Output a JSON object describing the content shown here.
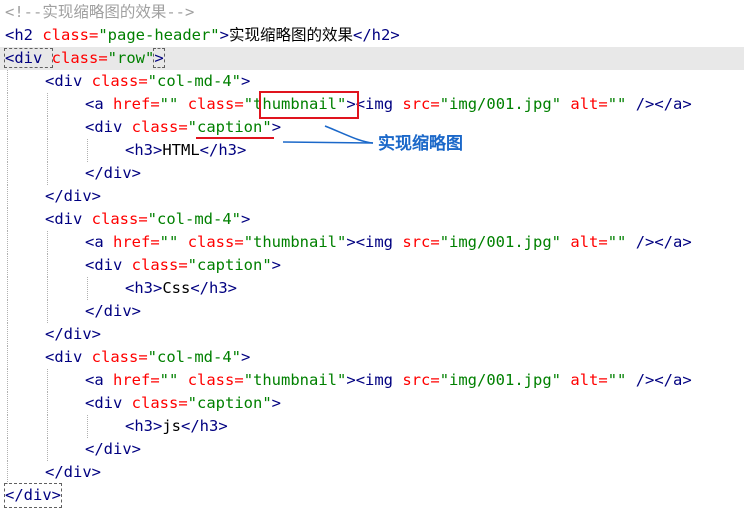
{
  "code": {
    "l1": {
      "comment": "<!--实现缩略图的效果-->"
    },
    "l2": {
      "open": "<h2 ",
      "attr": "class=",
      "value": "\"page-header\"",
      "close": ">",
      "text": "实现缩略图的效果",
      "end": "</h2>"
    },
    "l3": {
      "open": "<div ",
      "attr": "class=",
      "value": "\"row\"",
      "close": ">"
    },
    "l4": {
      "open": "<div ",
      "attr": "class=",
      "value": "\"col-md-4\"",
      "close": ">"
    },
    "l5": {
      "open": "<a ",
      "attr1": "href=",
      "value1": "\"\"",
      "attr2": "class=",
      "value2a": "\"",
      "value2b": "thumbnail",
      "value2c": "\"",
      "close": ">",
      "img_open": "<img ",
      "attr3": "src=",
      "value3": "\"img/001.jpg\"",
      "attr4": "alt=",
      "value4": "\"\"",
      "end": " /></a>"
    },
    "l6": {
      "open": "<div ",
      "attr": "class=",
      "value_a": "\"",
      "value_b": "caption",
      "value_c": "\"",
      "close": ">"
    },
    "l7": {
      "open": "<h3>",
      "text": "HTML",
      "end": "</h3>"
    },
    "l8": {
      "end": "</div>"
    },
    "l9": {
      "end": "</div>"
    },
    "l10": {
      "open": "<div ",
      "attr": "class=",
      "value": "\"col-md-4\"",
      "close": ">"
    },
    "l11": {
      "open": "<a ",
      "attr1": "href=",
      "value1": "\"\"",
      "attr2": "class=",
      "value2": "\"thumbnail\"",
      "close": ">",
      "img_open": "<img ",
      "attr3": "src=",
      "value3": "\"img/001.jpg\"",
      "attr4": "alt=",
      "value4": "\"\"",
      "end": " /></a>"
    },
    "l12": {
      "open": "<div ",
      "attr": "class=",
      "value": "\"caption\"",
      "close": ">"
    },
    "l13": {
      "open": "<h3>",
      "text": "Css",
      "end": "</h3>"
    },
    "l14": {
      "end": "</div>"
    },
    "l15": {
      "end": "</div>"
    },
    "l16": {
      "open": "<div ",
      "attr": "class=",
      "value": "\"col-md-4\"",
      "close": ">"
    },
    "l17": {
      "open": "<a ",
      "attr1": "href=",
      "value1": "\"\"",
      "attr2": "class=",
      "value2": "\"thumbnail\"",
      "close": ">",
      "img_open": "<img ",
      "attr3": "src=",
      "value3": "\"img/001.jpg\"",
      "attr4": "alt=",
      "value4": "\"\"",
      "end": " /></a>"
    },
    "l18": {
      "open": "<div ",
      "attr": "class=",
      "value": "\"caption\"",
      "close": ">"
    },
    "l19": {
      "open": "<h3>",
      "text": "js",
      "end": "</h3>"
    },
    "l20": {
      "end": "</div>"
    },
    "l21": {
      "end": "</div>"
    },
    "l22": {
      "end": "</div>"
    }
  },
  "annotation": {
    "label": "实现缩略图",
    "color_box": "#e0141e",
    "color_label": "#1b68c9"
  },
  "colors": {
    "tag": "#000080",
    "attribute": "#ff0000",
    "value": "#008000",
    "comment": "#a0a0a0",
    "current_line": "#e8e8e8"
  }
}
